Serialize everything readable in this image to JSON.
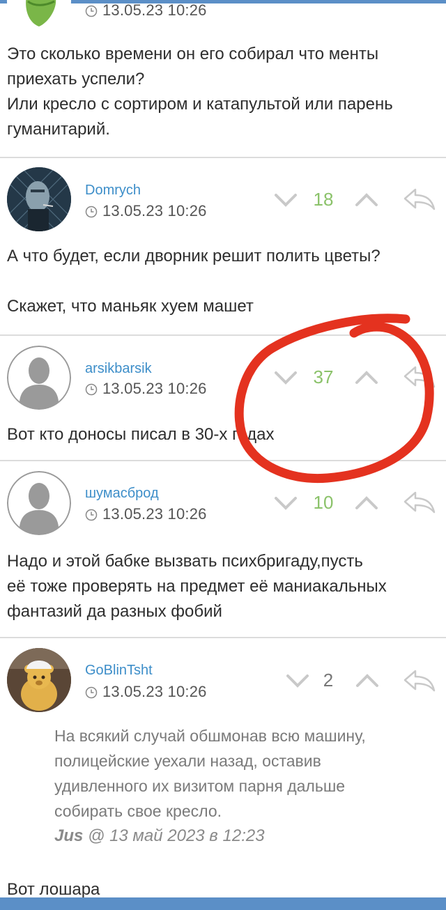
{
  "comments": [
    {
      "timestamp": "13.05.23 10:26",
      "body": "Это сколько времени он его собирал что менты\nприехать успели?\nИли кресло с сортиром и катапультой или парень\nгуманитарий."
    },
    {
      "username": "Domrych",
      "timestamp": "13.05.23 10:26",
      "score": "18",
      "body": "А что будет, если дворник решит полить цветы?\n\nСкажет, что маньяк хуем машет"
    },
    {
      "username": "arsikbarsik",
      "timestamp": "13.05.23 10:26",
      "score": "37",
      "body": "Вот кто доносы писал в 30-х годах"
    },
    {
      "username": "шумасброд",
      "timestamp": "13.05.23 10:26",
      "score": "10",
      "body": "Надо и этой бабке вызвать психбригаду,пусть\nеё тоже проверять на предмет её маниакальных\nфантазий да разных фобий"
    },
    {
      "username": "GoBlinTsht",
      "timestamp": "13.05.23 10:26",
      "score": "2",
      "quote": "На всякий случай обшмонав всю машину,\nполицейские уехали назад, оставив\nудивленного их визитом парня дальше\nсобирать свое кресло.",
      "quote_author": "Jus",
      "quote_meta": "@ 13 май 2023 в 12:23",
      "body": "Вот лошара"
    }
  ],
  "colors": {
    "username": "#3d8ec9",
    "score_positive": "#8bc26a",
    "score_neutral": "#777777",
    "annotation": "#e4321f",
    "accent_bar": "#5b8fc7"
  },
  "icons": [
    "clock-icon",
    "vote-down-icon",
    "vote-up-icon",
    "reply-icon",
    "avatar-placeholder-icon"
  ]
}
